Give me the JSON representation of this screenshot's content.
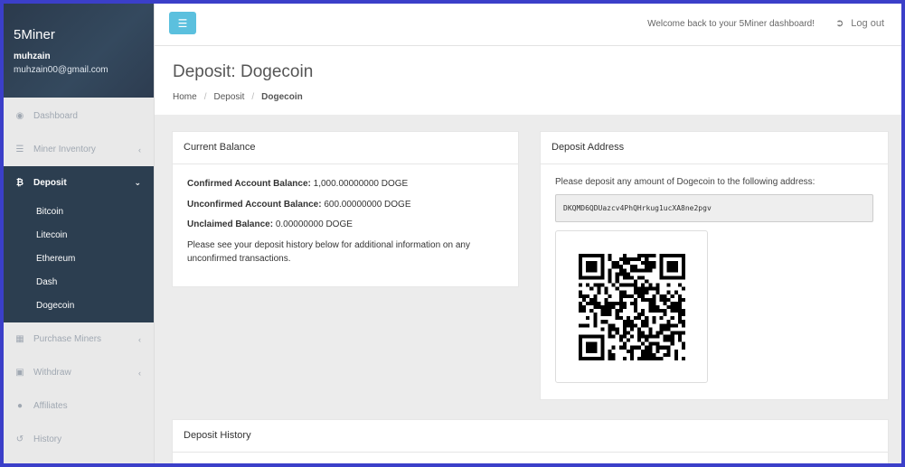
{
  "sidebar": {
    "app_name": "5Miner",
    "username": "muhzain",
    "email": "muhzain00@gmail.com",
    "items": [
      {
        "label": "Dashboard",
        "icon": "dashboard-icon"
      },
      {
        "label": "Miner Inventory",
        "icon": "list-icon"
      },
      {
        "label": "Deposit",
        "icon": "bitcoin-icon"
      },
      {
        "label": "Purchase Miners",
        "icon": "table-icon"
      },
      {
        "label": "Withdraw",
        "icon": "money-icon"
      },
      {
        "label": "Affiliates",
        "icon": "users-icon"
      },
      {
        "label": "History",
        "icon": "history-icon"
      }
    ],
    "deposit_sub": [
      "Bitcoin",
      "Litecoin",
      "Ethereum",
      "Dash",
      "Dogecoin"
    ]
  },
  "topbar": {
    "welcome": "Welcome back to your 5Miner dashboard!",
    "logout": "Log out"
  },
  "page": {
    "title": "Deposit: Dogecoin",
    "breadcrumb": [
      "Home",
      "Deposit",
      "Dogecoin"
    ]
  },
  "balance_panel": {
    "title": "Current Balance",
    "confirmed_label": "Confirmed Account Balance:",
    "confirmed_value": "1,000.00000000 DOGE",
    "unconfirmed_label": "Unconfirmed Account Balance:",
    "unconfirmed_value": "600.00000000 DOGE",
    "unclaimed_label": "Unclaimed Balance:",
    "unclaimed_value": "0.00000000 DOGE",
    "note": "Please see your deposit history below for additional information on any unconfirmed transactions."
  },
  "address_panel": {
    "title": "Deposit Address",
    "instruction": "Please deposit any amount of Dogecoin to the following address:",
    "address": "DKQMD6QDUazcv4PhQHrkug1ucXA8ne2pgv"
  },
  "history_panel": {
    "title": "Deposit History"
  }
}
